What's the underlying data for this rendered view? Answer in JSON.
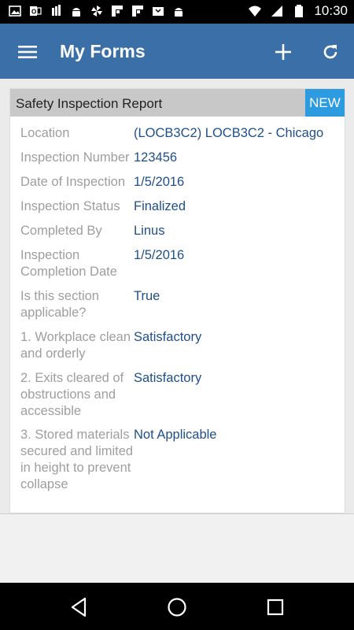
{
  "status_bar": {
    "time": "10:30",
    "left_icons": [
      "gallery-icon",
      "outlook-icon",
      "sim-icon",
      "android-icon",
      "pinwheel-icon",
      "flipboard-icon",
      "flipboard-icon",
      "inbox-icon",
      "android-icon"
    ],
    "right_icons": [
      "wifi-icon",
      "signal-icon",
      "battery-icon"
    ]
  },
  "app_bar": {
    "title": "My Forms",
    "background": "#3b6fa8"
  },
  "form_card": {
    "title": "Safety Inspection Report",
    "badge": "NEW",
    "badge_color": "#2d9be0",
    "fields": [
      {
        "label": "Location",
        "value": "(LOCB3C2) LOCB3C2 - Chicago"
      },
      {
        "label": "Inspection Number",
        "value": "123456"
      },
      {
        "label": "Date of Inspection",
        "value": "1/5/2016"
      },
      {
        "label": "Inspection Status",
        "value": "Finalized"
      },
      {
        "label": "Completed By",
        "value": "Linus"
      },
      {
        "label": "Inspection Completion Date",
        "value": "1/5/2016"
      },
      {
        "label": "Is this section applicable?",
        "value": "True"
      },
      {
        "label": "1. Workplace clean and orderly",
        "value": "Satisfactory"
      },
      {
        "label": "2. Exits cleared of obstructions and accessible",
        "value": "Satisfactory"
      },
      {
        "label": "3. Stored materials secured and limited in height to prevent collapse",
        "value": "Not Applicable"
      }
    ]
  },
  "nav_bar": {
    "buttons": [
      "back-icon",
      "home-icon",
      "recents-icon"
    ]
  }
}
